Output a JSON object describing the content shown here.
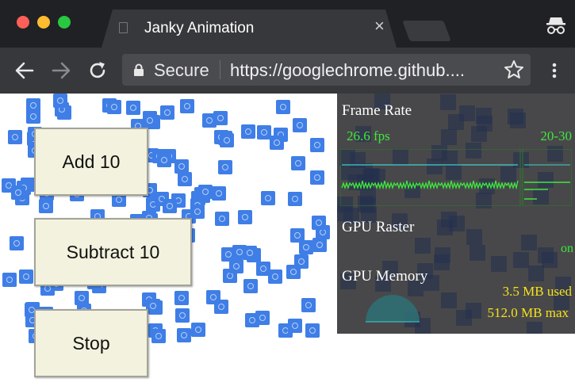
{
  "browser": {
    "tab": {
      "title": "Janky Animation",
      "close_glyph": "×"
    },
    "toolbar": {
      "security_label": "Secure",
      "url": "https://googlechrome.github....",
      "back_icon": "back-arrow-icon",
      "forward_icon": "forward-arrow-icon",
      "reload_icon": "reload-icon",
      "star_icon": "bookmark-star-icon",
      "menu_icon": "kebab-menu-icon"
    },
    "colors": {
      "frame": "#202124",
      "tab": "#37383b",
      "omnibox": "#4a4b4f"
    }
  },
  "app": {
    "buttons": {
      "add": "Add 10",
      "subtract": "Subtract 10",
      "stop": "Stop"
    },
    "sprite_color": "#3f7ee6"
  },
  "hud": {
    "frame_rate": {
      "title": "Frame Rate",
      "fps": "26.6 fps",
      "range": "20-30"
    },
    "gpu_raster": {
      "title": "GPU Raster",
      "state": "on"
    },
    "gpu_memory": {
      "title": "GPU Memory",
      "used": "3.5 MB used",
      "max": "512.0 MB max"
    },
    "colors": {
      "green": "#3ee83e",
      "yellow": "#f5e21c",
      "cyan": "#3fd0d0"
    }
  }
}
